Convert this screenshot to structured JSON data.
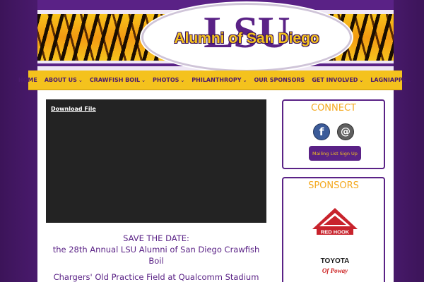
{
  "header": {
    "logo_main": "LSU",
    "logo_sub": "Alumni of San Diego"
  },
  "nav": {
    "items": [
      {
        "label": "HOME",
        "has_dropdown": false
      },
      {
        "label": "ABOUT US",
        "has_dropdown": true
      },
      {
        "label": "CRAWFISH BOIL",
        "has_dropdown": true
      },
      {
        "label": "PHOTOS",
        "has_dropdown": true
      },
      {
        "label": "PHILANTHROPY",
        "has_dropdown": true
      },
      {
        "label": "OUR SPONSORS",
        "has_dropdown": false
      },
      {
        "label": "GET INVOLVED",
        "has_dropdown": true
      },
      {
        "label": "LAGNIAPPE",
        "has_dropdown": true
      }
    ],
    "chevron": "⌄"
  },
  "main": {
    "video": {
      "download_label": "Download File"
    },
    "save_the_date": "SAVE THE DATE:",
    "event_line": "the 28th Annual LSU Alumni of San Diego Crawfish Boil",
    "venue_line": "Chargers' Old Practice Field at Qualcomm Stadium"
  },
  "sidebar": {
    "connect": {
      "title": "CONNECT",
      "facebook_glyph": "f",
      "email_glyph": "@",
      "mailing_button": "Mailing List Sign Up"
    },
    "sponsors": {
      "title": "SPONSORS",
      "redhook_text": "RED HOOK",
      "toyota_text": "TOYOTA",
      "poway_text": "Of Poway"
    }
  },
  "colors": {
    "purple": "#5a2286",
    "gold": "#f4c21d",
    "orange_title": "#f4a81d"
  }
}
